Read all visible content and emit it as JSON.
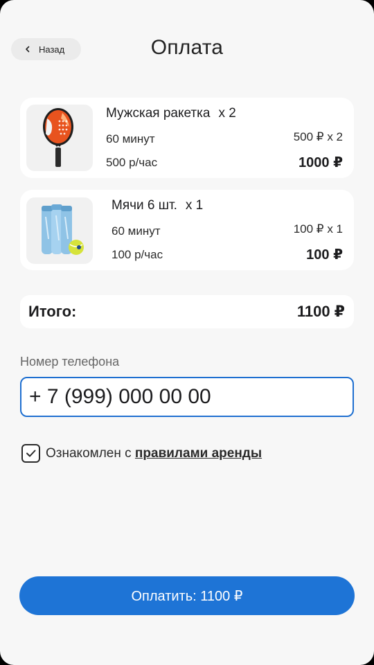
{
  "header": {
    "back_label": "Назад",
    "title": "Оплата"
  },
  "items": [
    {
      "name": "Мужская ракетка",
      "qty": "x 2",
      "duration": "60 минут",
      "rate": "500 р/час",
      "unit_price": "500 ₽ x 2",
      "total": "1000 ₽",
      "image_icon": "padel-racket-icon"
    },
    {
      "name": "Мячи 6 шт.",
      "qty": "x 1",
      "duration": "60 минут",
      "rate": "100 р/час",
      "unit_price": "100 ₽ x 1",
      "total": "100 ₽",
      "image_icon": "tennis-balls-icon"
    }
  ],
  "summary": {
    "label": "Итого:",
    "value": "1100 ₽"
  },
  "phone": {
    "label": "Номер телефона",
    "value": "+ 7 (999) 000 00 00"
  },
  "agreement": {
    "checked": true,
    "text": "Ознакомлен с",
    "link": "правилами аренды"
  },
  "pay_button": {
    "label": "Оплатить: 1100 ₽"
  },
  "colors": {
    "accent": "#1e74d6",
    "background": "#f7f7f7"
  }
}
